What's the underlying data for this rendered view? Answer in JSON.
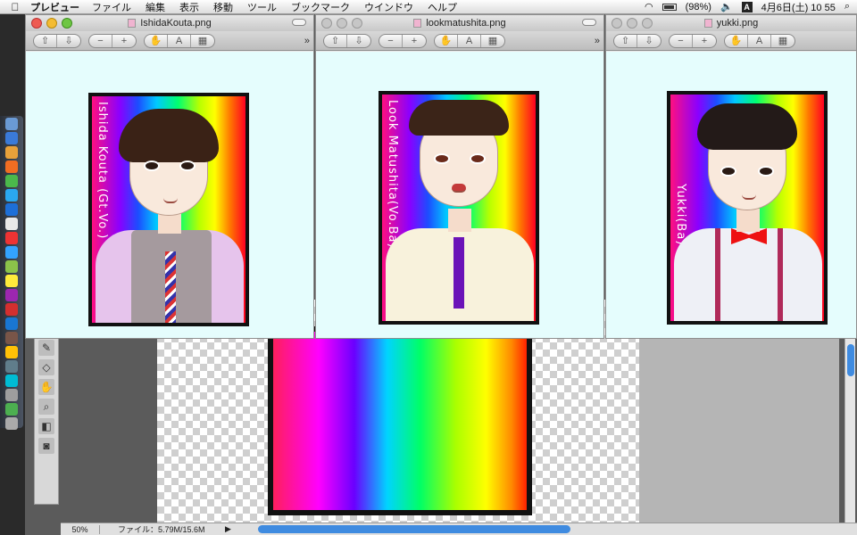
{
  "menubar": {
    "apple": "",
    "app": "プレビュー",
    "menus": [
      "ファイル",
      "編集",
      "表示",
      "移動",
      "ツール",
      "ブックマーク",
      "ウインドウ",
      "ヘルプ"
    ],
    "battery": "(98%)",
    "input_method": "A",
    "clock": "4月6日(土)  10 55"
  },
  "photoshop": {
    "zoom": "50%",
    "file_info": "ファイル：5.79M/15.6M"
  },
  "windows": [
    {
      "title": "IshidaKouta.png",
      "art_name": "Ishida Kouta (Gt.Vo.)"
    },
    {
      "title": "lookmatushita.png",
      "art_name": "Look Matushita(Vo.Ba)"
    },
    {
      "title": "yukki.png",
      "art_name": "Yukki(Ba)"
    }
  ],
  "toolbar": {
    "back": "⇧",
    "forward": "⇩",
    "zoom_out": "−",
    "zoom_in": "+",
    "hand": "✋",
    "text_select": "A",
    "view": "▦",
    "more": "»"
  }
}
